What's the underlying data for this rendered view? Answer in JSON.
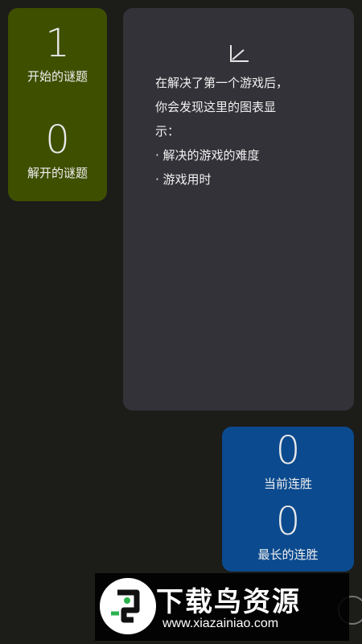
{
  "stats_left": {
    "started_count": "1",
    "started_label": "开始的谜题",
    "solved_count": "0",
    "solved_label": "解开的谜题"
  },
  "chart_panel": {
    "icon": "chart-icon",
    "line1": "在解决了第一个游戏后，",
    "line2": "你会发现这里的图表显",
    "line3": "示：",
    "bullet1": "· 解决的游戏的难度",
    "bullet2": "· 游戏用时"
  },
  "streak": {
    "current_count": "0",
    "current_label": "当前连胜",
    "longest_count": "0",
    "longest_label": "最长的连胜"
  },
  "watermark": {
    "title": "下载鸟资源",
    "url": "www.xiazainiao.com"
  },
  "colors": {
    "background": "#1c1c19",
    "green_card": "#3f4f00",
    "chart_card": "#323238",
    "blue_card": "#0b4a8e"
  }
}
